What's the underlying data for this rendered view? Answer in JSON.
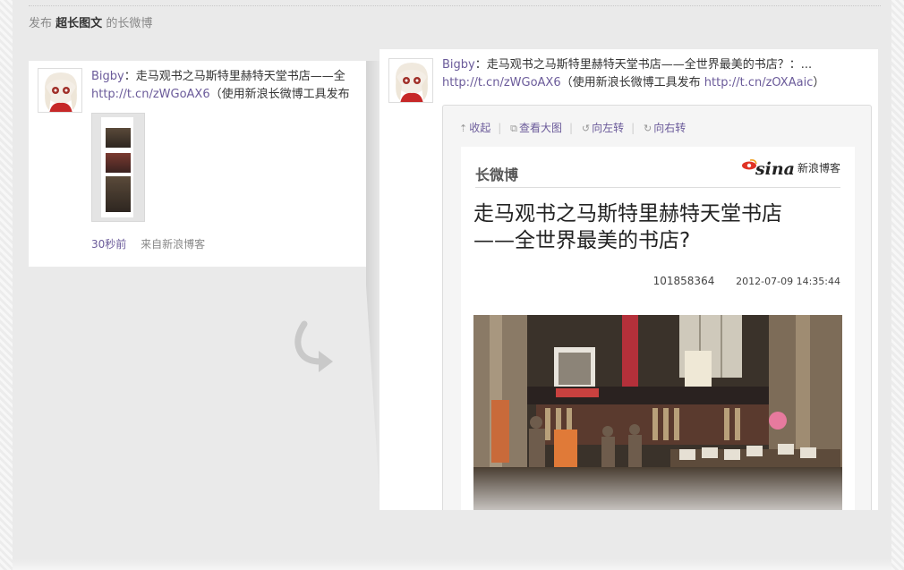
{
  "header": {
    "prefix": "发布",
    "highlight": "超长图文",
    "suffix": "的长微博"
  },
  "left_post": {
    "author": "Bigby",
    "text": "：走马观书之马斯特里赫特天堂书店——全",
    "link": "http://t.cn/zWGoAX6",
    "link_suffix": "（使用新浪长微博工具发布",
    "time": "30秒前",
    "source": "来自新浪博客"
  },
  "right_post": {
    "author": "Bigby",
    "text": "：走马观书之马斯特里赫特天堂书店——全世界最美的书店？：...",
    "link1": "http://t.cn/zWGoAX6",
    "mid_text": "（使用新浪长微博工具发布",
    "link2": "http://t.cn/zOXAaic",
    "end_text": "）"
  },
  "toolbar": {
    "collapse": "收起",
    "view_large": "查看大图",
    "rotate_left": "向左转",
    "rotate_right": "向右转"
  },
  "long_image": {
    "brand_left": "长微博",
    "brand_logo": "sina",
    "brand_right": "新浪博客",
    "title_line1": "走马观书之马斯特里赫特天堂书店",
    "title_line2": "——全世界最美的书店?",
    "post_id": "101858364",
    "datetime": "2012-07-09 14:35:44"
  },
  "colors": {
    "link": "#6b5b9a",
    "panel_bg": "#eaeaea",
    "card_bg": "#ffffff"
  },
  "icons": {
    "collapse": "arrow-up-icon",
    "view_large": "external-link-icon",
    "rotate_left": "rotate-left-icon",
    "rotate_right": "rotate-right-icon",
    "flow": "curved-arrow-icon"
  }
}
